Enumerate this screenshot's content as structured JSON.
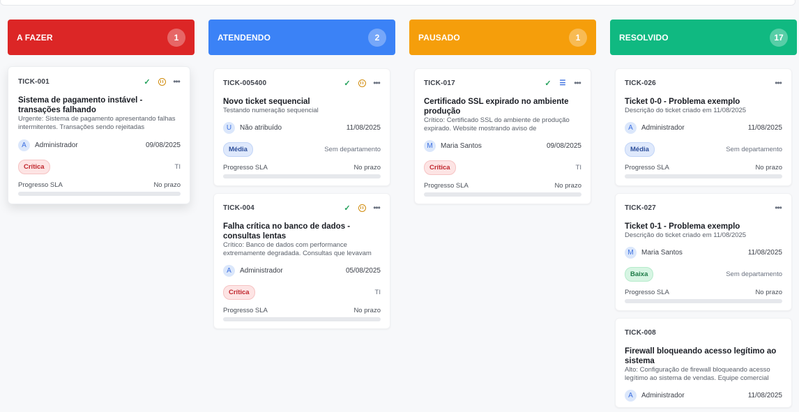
{
  "columns": [
    {
      "title": "A FAZER",
      "count": "1",
      "color": "#dc2626",
      "cards": [
        {
          "id": "TICK-001",
          "title": "Sistema de pagamento instável - transações falhando",
          "desc": "Urgente: Sistema de pagamento apresentando falhas intermitentes. Transações sendo rejeitadas",
          "assignee": "Administrador",
          "avatar": "A",
          "date": "09/08/2025",
          "priority": "Crítica",
          "dept": "TI",
          "sla_label": "Progresso SLA",
          "sla_status": "No prazo",
          "sla_progress": 0
        }
      ]
    },
    {
      "title": "ATENDENDO",
      "count": "2",
      "color": "#3b82f6",
      "cards": [
        {
          "id": "TICK-005400",
          "title": "Novo ticket sequencial",
          "desc": "Testando numeração sequencial",
          "assignee": "Não atribuído",
          "avatar": "U",
          "date": "11/08/2025",
          "priority": "Média",
          "dept": "Sem departamento",
          "sla_label": "Progresso SLA",
          "sla_status": "No prazo",
          "sla_progress": 0
        },
        {
          "id": "TICK-004",
          "title": "Falha crítica no banco de dados - consultas lentas",
          "desc": "Crítico: Banco de dados com performance extremamente degradada. Consultas que levavam",
          "assignee": "Administrador",
          "avatar": "A",
          "date": "05/08/2025",
          "priority": "Crítica",
          "dept": "TI",
          "sla_label": "Progresso SLA",
          "sla_status": "No prazo",
          "sla_progress": 0
        }
      ]
    },
    {
      "title": "PAUSADO",
      "count": "1",
      "color": "#f59e0b",
      "cards": [
        {
          "id": "TICK-017",
          "title": "Certificado SSL expirado no ambiente produção",
          "desc": "Crítico: Certificado SSL do ambiente de produção expirado. Website mostrando aviso de",
          "assignee": "Maria Santos",
          "avatar": "M",
          "date": "09/08/2025",
          "priority": "Crítica",
          "dept": "TI",
          "sla_label": "Progresso SLA",
          "sla_status": "No prazo",
          "sla_progress": 0
        }
      ]
    },
    {
      "title": "RESOLVIDO",
      "count": "17",
      "color": "#10b981",
      "cards": [
        {
          "id": "TICK-026",
          "title": "Ticket 0-0 - Problema exemplo",
          "desc": "Descrição do ticket criado em 11/08/2025",
          "assignee": "Administrador",
          "avatar": "A",
          "date": "11/08/2025",
          "priority": "Média",
          "dept": "Sem departamento",
          "sla_label": "Progresso SLA",
          "sla_status": "No prazo",
          "sla_progress": 0
        },
        {
          "id": "TICK-027",
          "title": "Ticket 0-1 - Problema exemplo",
          "desc": "Descrição do ticket criado em 11/08/2025",
          "assignee": "Maria Santos",
          "avatar": "M",
          "date": "11/08/2025",
          "priority": "Baixa",
          "dept": "Sem departamento",
          "sla_label": "Progresso SLA",
          "sla_status": "No prazo",
          "sla_progress": 0
        },
        {
          "id": "TICK-008",
          "title": "Firewall bloqueando acesso legítimo ao sistema",
          "desc": "Alto: Configuração de firewall bloqueando acesso legítimo ao sistema de vendas. Equipe comercial",
          "assignee": "Administrador",
          "avatar": "A",
          "date": "11/08/2025"
        }
      ]
    }
  ],
  "icons": {
    "check": "check-icon",
    "pause": "pause-icon",
    "list": "list-icon",
    "more": "more-icon"
  }
}
